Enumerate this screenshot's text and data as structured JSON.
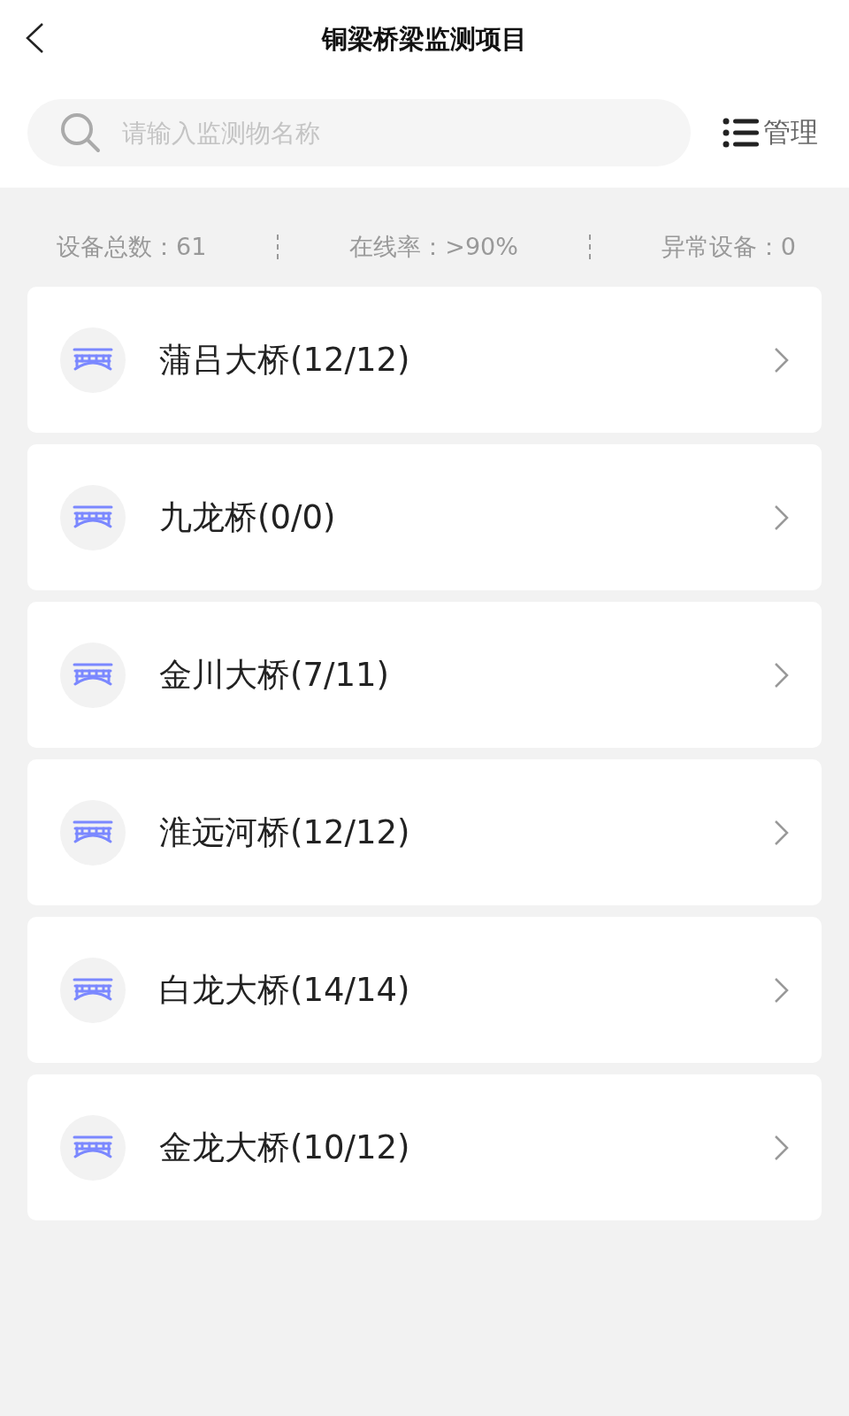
{
  "header": {
    "title": "铜梁桥梁监测项目"
  },
  "search": {
    "placeholder": "请输入监测物名称"
  },
  "manage_button": {
    "label": "管理"
  },
  "stats": [
    "设备总数：61",
    "在线率：>90%",
    "异常设备：0"
  ],
  "bridges": [
    {
      "name": "蒲吕大桥(12/12)"
    },
    {
      "name": "九龙桥(0/0)"
    },
    {
      "name": "金川大桥(7/11)"
    },
    {
      "name": "淮远河桥(12/12)"
    },
    {
      "name": "白龙大桥(14/14)"
    },
    {
      "name": "金龙大桥(10/12)"
    }
  ]
}
